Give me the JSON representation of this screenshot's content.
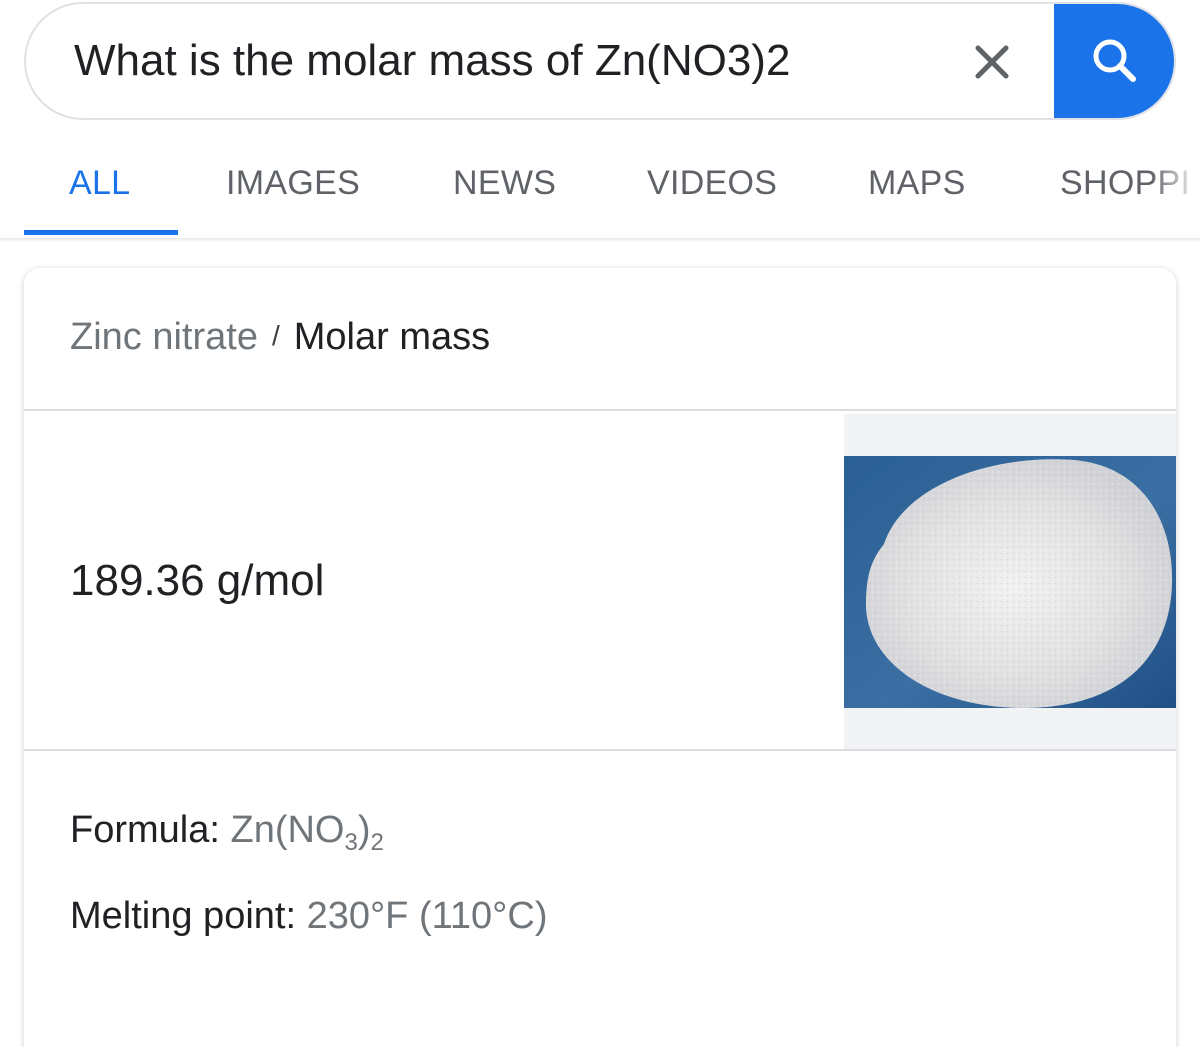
{
  "search": {
    "query": "What is the molar mass of Zn(NO3)2",
    "clear_icon": "close-icon",
    "search_icon": "search-icon",
    "accent_color": "#1a73e8"
  },
  "tabs": [
    {
      "label": "ALL",
      "active": true
    },
    {
      "label": "IMAGES",
      "active": false
    },
    {
      "label": "NEWS",
      "active": false
    },
    {
      "label": "VIDEOS",
      "active": false
    },
    {
      "label": "MAPS",
      "active": false
    },
    {
      "label": "SHOPPI",
      "active": false
    }
  ],
  "card": {
    "breadcrumb": {
      "entity": "Zinc nitrate",
      "separator": "/",
      "attribute": "Molar mass"
    },
    "answer": "189.36 g/mol",
    "facts": [
      {
        "label": "Formula:",
        "value_parts": [
          "Zn(NO",
          "3",
          ")",
          "2"
        ]
      },
      {
        "label": "Melting point:",
        "value": "230°F (110°C)"
      }
    ]
  }
}
